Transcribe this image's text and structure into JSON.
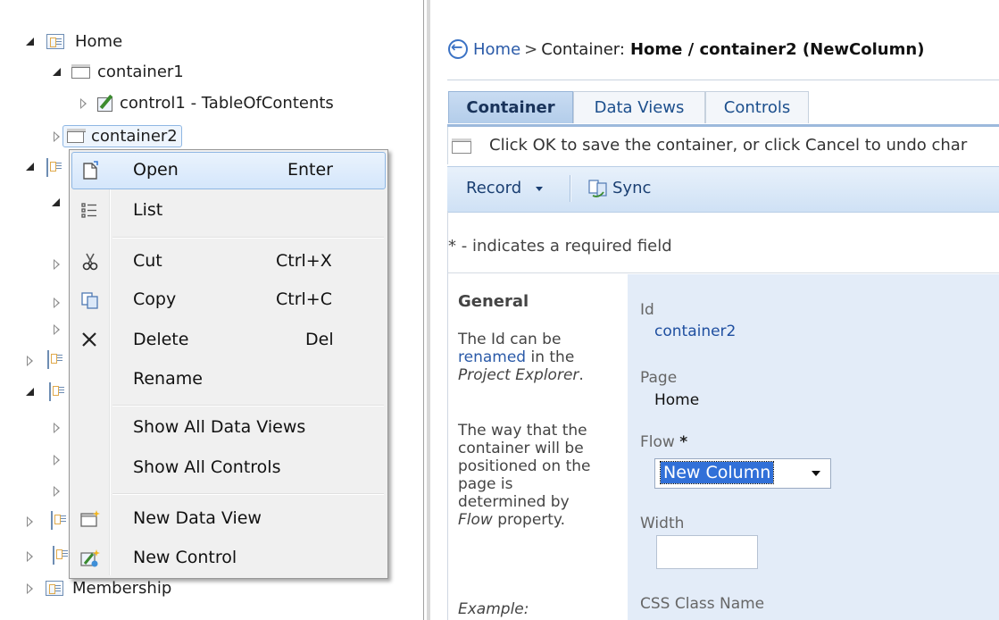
{
  "tree": {
    "home": "Home",
    "container1": "container1",
    "control1": "control1 - TableOfContents",
    "container2": "container2",
    "membership": "Membership"
  },
  "context_menu": {
    "items": [
      {
        "label": "Open",
        "shortcut": "Enter",
        "icon": "open-icon"
      },
      {
        "label": "List",
        "shortcut": "",
        "icon": "list-icon"
      },
      {
        "label": "Cut",
        "shortcut": "Ctrl+X",
        "icon": "scissors-icon"
      },
      {
        "label": "Copy",
        "shortcut": "Ctrl+C",
        "icon": "copy-icon"
      },
      {
        "label": "Delete",
        "shortcut": "Del",
        "icon": "delete-x-icon"
      },
      {
        "label": "Rename",
        "shortcut": "",
        "icon": ""
      },
      {
        "label": "Show All Data Views",
        "shortcut": "",
        "icon": ""
      },
      {
        "label": "Show All Controls",
        "shortcut": "",
        "icon": ""
      },
      {
        "label": "New Data View",
        "shortcut": "",
        "icon": "new-data-view-icon"
      },
      {
        "label": "New Control",
        "shortcut": "",
        "icon": "new-control-icon"
      }
    ]
  },
  "breadcrumb": {
    "home_link": "Home",
    "separator": ">",
    "prefix": "Container:",
    "current": "Home / container2 (NewColumn)"
  },
  "tabs": [
    "Container",
    "Data Views",
    "Controls"
  ],
  "message": "Click OK to save the container, or click Cancel to undo char",
  "toolbar": {
    "record": "Record",
    "sync": "Sync"
  },
  "required_note": "* - indicates a required field",
  "help": {
    "title": "General",
    "p1_start": "The Id can be",
    "p1_link": "renamed",
    "p1_mid": "in the",
    "p1_em": "Project Explorer",
    "p1_end": ".",
    "p2_lines": [
      "The way that the",
      "container will be",
      "positioned on the",
      "page is",
      "determined by"
    ],
    "p2_em": "Flow",
    "p2_end": "property.",
    "example": "Example:"
  },
  "fields": {
    "id_label": "Id",
    "id_value": "container2",
    "page_label": "Page",
    "page_value": "Home",
    "flow_label": "Flow",
    "flow_required": "*",
    "flow_value": "New Column",
    "width_label": "Width",
    "css_label": "CSS Class Name"
  },
  "colors": {
    "accent": "#3170d8",
    "tab_active": "#b3cdea",
    "menu_highlight": "#d4e6fb"
  }
}
